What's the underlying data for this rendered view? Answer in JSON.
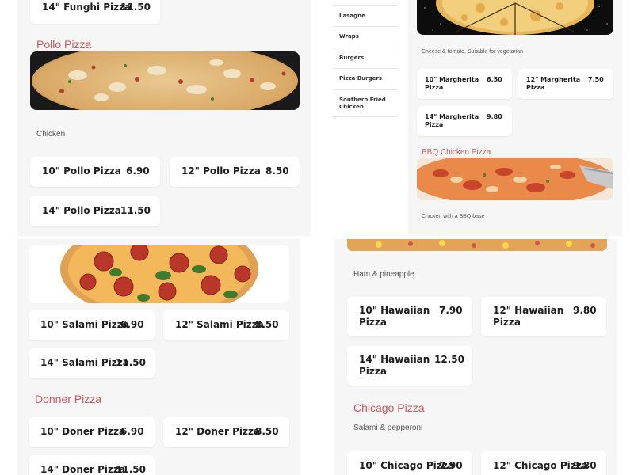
{
  "colors": {
    "heading": "#c9585f",
    "panel": "#f6f6f6",
    "card": "#ffffff"
  },
  "top_left": {
    "funghi": {
      "name": "14\" Funghi Pizza",
      "price": "11.50"
    },
    "pollo": {
      "heading": "Pollo Pizza",
      "description": "Chicken",
      "items": [
        {
          "name": "10\" Pollo Pizza",
          "price": "6.90"
        },
        {
          "name": "12\" Pollo Pizza",
          "price": "8.50"
        },
        {
          "name": "14\" Pollo Pizza",
          "price": "11.50"
        }
      ]
    }
  },
  "sidebar": {
    "items": [
      {
        "label": "Lasagne"
      },
      {
        "label": "Wraps"
      },
      {
        "label": "Burgers"
      },
      {
        "label": "Pizza Burgers"
      },
      {
        "label": "Southern Fried Chicken"
      }
    ]
  },
  "top_right": {
    "margherita": {
      "description": "Cheese & tomato. Suitable for vegetarian",
      "items": [
        {
          "name": "10\" Margherita Pizza",
          "price": "6.50"
        },
        {
          "name": "12\" Margherita Pizza",
          "price": "7.50"
        },
        {
          "name": "14\" Margherita Pizza",
          "price": "9.80"
        }
      ]
    },
    "bbq": {
      "heading": "BBQ Chicken Pizza",
      "description": "Chicken with a BBQ base"
    }
  },
  "bottom_left": {
    "salami": {
      "items": [
        {
          "name": "10\" Salami Pizza",
          "price": "6.90"
        },
        {
          "name": "12\" Salami Pizza",
          "price": "8.50"
        },
        {
          "name": "14\" Salami Pizza",
          "price": "11.50"
        }
      ]
    },
    "doner": {
      "heading": "Donner Pizza",
      "items": [
        {
          "name": "10\" Doner Pizza",
          "price": "6.90"
        },
        {
          "name": "12\" Doner Pizza",
          "price": "8.50"
        },
        {
          "name": "14\" Doner Pizza",
          "price": "11.50"
        }
      ]
    }
  },
  "bottom_right": {
    "hawaiian": {
      "description": "Ham & pineapple",
      "items": [
        {
          "name": "10\" Hawaiian Pizza",
          "price": "7.90"
        },
        {
          "name": "12\" Hawaiian Pizza",
          "price": "9.80"
        },
        {
          "name": "14\" Hawaiian Pizza",
          "price": "12.50"
        }
      ]
    },
    "chicago": {
      "heading": "Chicago Pizza",
      "description": "Salami & pepperoni",
      "items": [
        {
          "name": "10\" Chicago Pizza",
          "price": "7.90"
        },
        {
          "name": "12\" Chicago Pizza",
          "price": "9.80"
        }
      ]
    }
  }
}
